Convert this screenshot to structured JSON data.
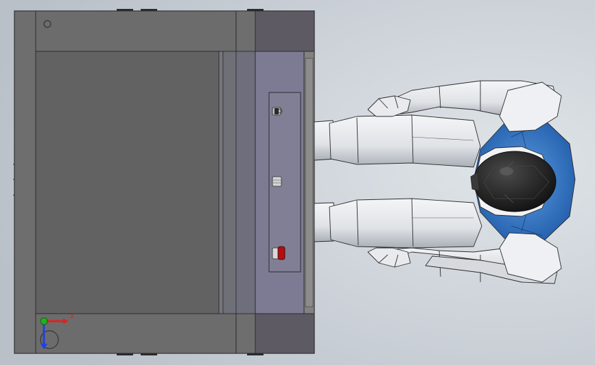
{
  "viewport": {
    "background_color": "#b9c0c8",
    "background_highlight": "#dfe4e8"
  },
  "machine": {
    "frame_color": "#6a6a6a",
    "panel_color": "#626262",
    "edge_color": "#2b2b2b",
    "lid_color": "#5e5a64",
    "control_panel_color": "#7d7b94",
    "stop_button_color": "#b01010"
  },
  "figure": {
    "body_color": "#e6e8ec",
    "shade_color": "#9aa0a8",
    "shoulder_color": "#2d6cc0",
    "head_color": "#1e1e1e"
  },
  "triad": {
    "x_label": "X",
    "x_color": "#e02020",
    "y_color": "#20b020",
    "z_color": "#2040e0"
  }
}
